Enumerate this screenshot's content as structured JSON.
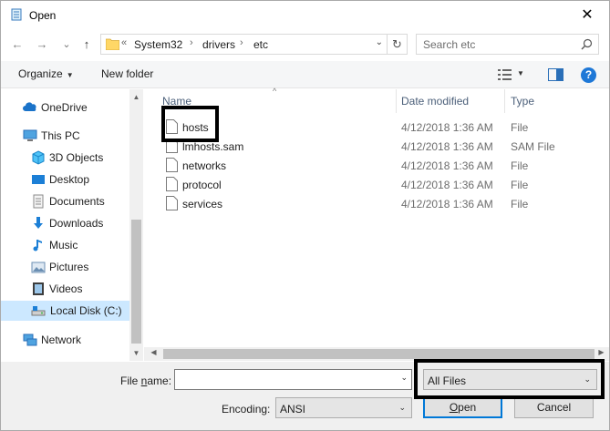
{
  "window": {
    "title": "Open",
    "close_glyph": "✕"
  },
  "nav": {
    "back_glyph": "←",
    "forward_glyph": "→",
    "recent_glyph": "⌄",
    "up_glyph": "↑",
    "address": {
      "overflow_glyph": "«",
      "crumbs": [
        "System32",
        "drivers",
        "etc"
      ],
      "separator": "›",
      "dropdown_glyph": "⌄",
      "refresh_glyph": "↻"
    },
    "search": {
      "placeholder": "Search etc"
    }
  },
  "toolbar": {
    "organize_label": "Organize",
    "caret": "▼",
    "new_folder_label": "New folder",
    "help_glyph": "?"
  },
  "sidebar": {
    "items": [
      {
        "label": "OneDrive",
        "icon": "onedrive-icon"
      },
      {
        "label": "This PC",
        "icon": "computer-icon"
      },
      {
        "label": "3D Objects",
        "icon": "cube-icon"
      },
      {
        "label": "Desktop",
        "icon": "desktop-icon"
      },
      {
        "label": "Documents",
        "icon": "documents-icon"
      },
      {
        "label": "Downloads",
        "icon": "download-icon"
      },
      {
        "label": "Music",
        "icon": "music-icon"
      },
      {
        "label": "Pictures",
        "icon": "pictures-icon"
      },
      {
        "label": "Videos",
        "icon": "videos-icon"
      },
      {
        "label": "Local Disk (C:)",
        "icon": "drive-icon",
        "selected": true
      },
      {
        "label": "Network",
        "icon": "network-icon"
      }
    ],
    "scroll_up": "▲",
    "scroll_down": "▼"
  },
  "files": {
    "columns": {
      "name": "Name",
      "date": "Date modified",
      "type": "Type"
    },
    "sort_glyph": "^",
    "rows": [
      {
        "name": "hosts",
        "date": "4/12/2018 1:36 AM",
        "type": "File"
      },
      {
        "name": "lmhosts.sam",
        "date": "4/12/2018 1:36 AM",
        "type": "SAM File"
      },
      {
        "name": "networks",
        "date": "4/12/2018 1:36 AM",
        "type": "File"
      },
      {
        "name": "protocol",
        "date": "4/12/2018 1:36 AM",
        "type": "File"
      },
      {
        "name": "services",
        "date": "4/12/2018 1:36 AM",
        "type": "File"
      }
    ],
    "scroll_left": "◀",
    "scroll_right": "▶"
  },
  "footer": {
    "file_name_label_prefix": "File ",
    "file_name_label_accel": "n",
    "file_name_label_suffix": "ame:",
    "file_name_value": "",
    "filter_value": "All Files",
    "encoding_label": "Encoding:",
    "encoding_value": "ANSI",
    "open_accel": "O",
    "open_rest": "pen",
    "cancel_label": "Cancel",
    "dropdown_glyph": "⌄"
  },
  "colors": {
    "selection": "#cce8ff",
    "accent": "#0078d7",
    "highlight_border": "#000000"
  }
}
